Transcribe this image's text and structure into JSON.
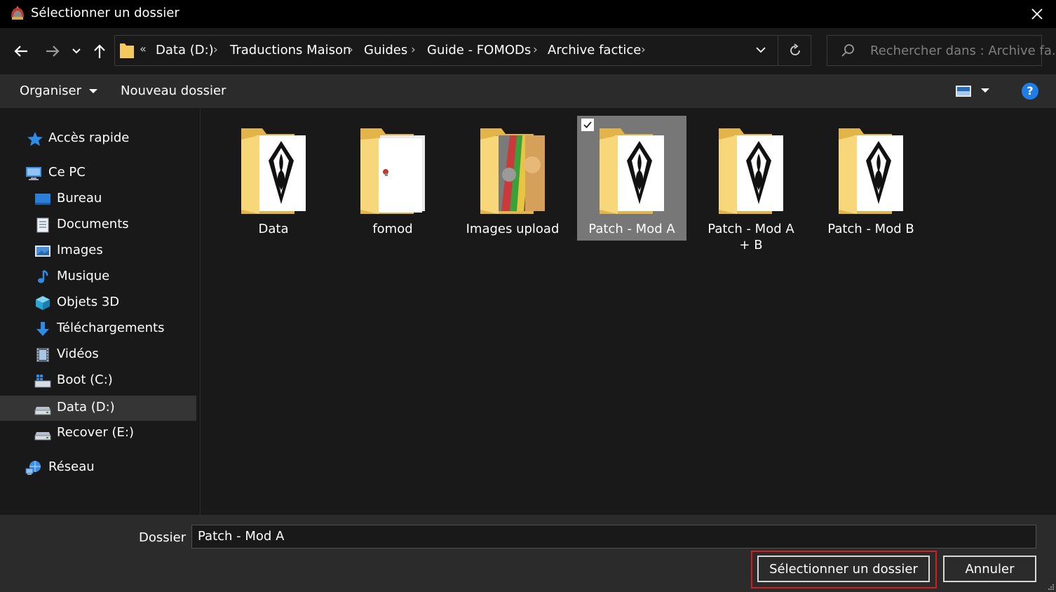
{
  "window": {
    "title": "Sélectionner un dossier",
    "close_glyph": "✕"
  },
  "nav": {
    "back_icon": "arrow-left-icon",
    "forward_icon": "arrow-right-icon",
    "recent_icon": "chevron-down-icon",
    "up_icon": "arrow-up-icon"
  },
  "address": {
    "overflow": "«",
    "crumbs": [
      "Data (D:)",
      "Traductions Maison",
      "Guides",
      "Guide - FOMODs",
      "Archive factice"
    ],
    "separator": "›"
  },
  "search": {
    "placeholder": "Rechercher dans : Archive fa..."
  },
  "toolbar": {
    "organize_label": "Organiser",
    "new_folder_label": "Nouveau dossier",
    "help_label": "?"
  },
  "sidebar": {
    "items": [
      {
        "label": "Accès rapide",
        "icon": "star-icon"
      },
      {
        "label": "Ce PC",
        "icon": "computer-icon"
      },
      {
        "label": "Bureau",
        "icon": "desktop-icon"
      },
      {
        "label": "Documents",
        "icon": "documents-icon"
      },
      {
        "label": "Images",
        "icon": "pictures-icon"
      },
      {
        "label": "Musique",
        "icon": "music-icon"
      },
      {
        "label": "Objets 3D",
        "icon": "cube-icon"
      },
      {
        "label": "Téléchargements",
        "icon": "download-icon"
      },
      {
        "label": "Vidéos",
        "icon": "video-icon"
      },
      {
        "label": "Boot (C:)",
        "icon": "windows-drive-icon"
      },
      {
        "label": "Data (D:)",
        "icon": "drive-icon"
      },
      {
        "label": "Recover (E:)",
        "icon": "drive-icon"
      },
      {
        "label": "Réseau",
        "icon": "network-icon"
      }
    ],
    "selected_label": "Data (D:)"
  },
  "folders": [
    {
      "label": "Data",
      "thumb": "skyrim-emblem"
    },
    {
      "label": "fomod",
      "thumb": "document"
    },
    {
      "label": "Images upload",
      "thumb": "cat-photo"
    },
    {
      "label": "Patch - Mod A",
      "thumb": "skyrim-emblem"
    },
    {
      "label": "Patch - Mod A + B",
      "thumb": "skyrim-emblem"
    },
    {
      "label": "Patch - Mod B",
      "thumb": "skyrim-emblem"
    }
  ],
  "selected_folder": "Patch - Mod A",
  "footer": {
    "folder_label": "Dossier :",
    "folder_value": "Patch - Mod A",
    "select_button": "Sélectionner un dossier",
    "cancel_button": "Annuler"
  },
  "colors": {
    "window_bg": "#191919",
    "panel_bg": "#2b2b2b",
    "selection": "#777777",
    "highlight_border": "#d41f1f",
    "folder_yellow": "#f4c95d",
    "accent_blue": "#1f7de6"
  }
}
